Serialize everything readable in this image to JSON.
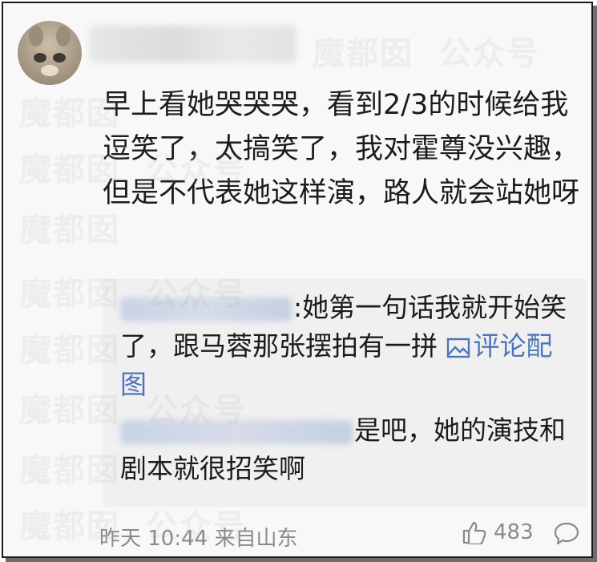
{
  "comment": {
    "text": "早上看她哭哭哭，看到2/3的时候给我逗笑了，太搞笑了，我对霍尊没兴趣，但是不代表她这样演，路人就会站她呀",
    "time": "昨天 10:44",
    "source": "来自山东",
    "likes": "483"
  },
  "replies": [
    {
      "text": "她第一句话我就开始笑了，跟马蓉那张摆拍有一拼",
      "image_link": "评论配图",
      "image_icon": "image-icon"
    },
    {
      "text": "是吧，她的演技和剧本就很招笑啊"
    }
  ],
  "watermark": {
    "text": "魔都囡",
    "text2": "公众号"
  },
  "colors": {
    "link": "#4d76b8",
    "meta": "#8a8a8a",
    "reply_bg": "#f0f0f0"
  },
  "icons": [
    "thumbs-up-icon",
    "comment-bubble-icon",
    "image-icon"
  ]
}
